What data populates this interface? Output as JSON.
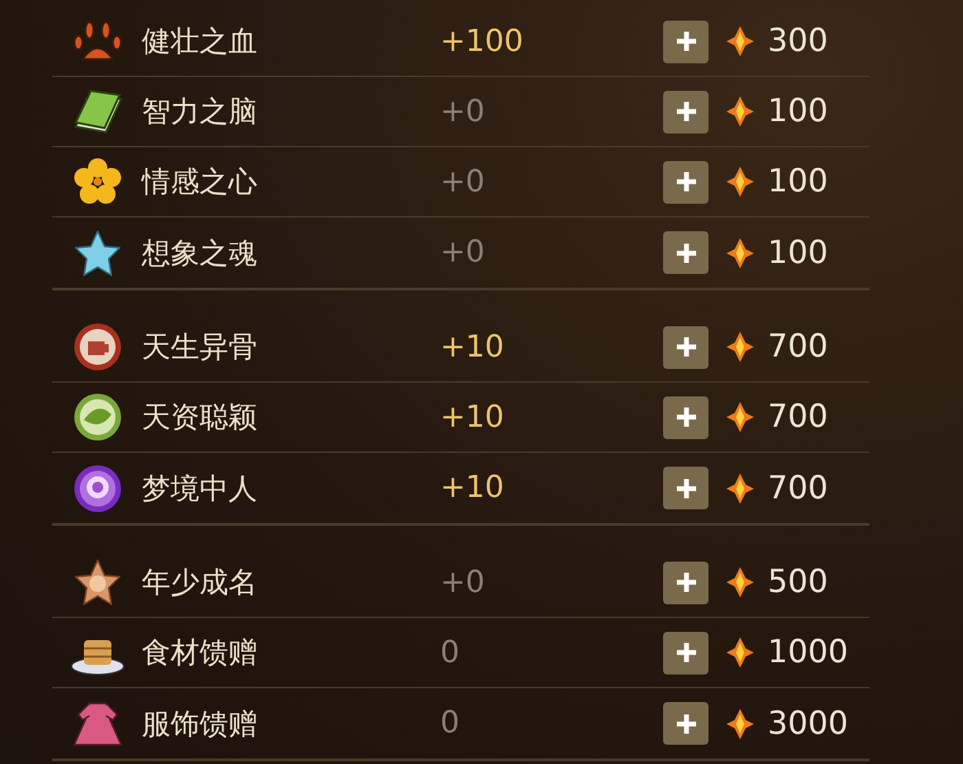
{
  "groups": [
    {
      "rows": [
        {
          "name": "健壮之血",
          "bonus": "+100",
          "highlighted": true,
          "cost": "300"
        },
        {
          "name": "智力之脑",
          "bonus": "+0",
          "highlighted": false,
          "cost": "100"
        },
        {
          "name": "情感之心",
          "bonus": "+0",
          "highlighted": false,
          "cost": "100"
        },
        {
          "name": "想象之魂",
          "bonus": "+0",
          "highlighted": false,
          "cost": "100"
        }
      ]
    },
    {
      "rows": [
        {
          "name": "天生异骨",
          "bonus": "+10",
          "highlighted": true,
          "cost": "700"
        },
        {
          "name": "天资聪颖",
          "bonus": "+10",
          "highlighted": true,
          "cost": "700"
        },
        {
          "name": "梦境中人",
          "bonus": "+10",
          "highlighted": true,
          "cost": "700"
        }
      ]
    },
    {
      "rows": [
        {
          "name": "年少成名",
          "bonus": "+0",
          "highlighted": false,
          "cost": "500"
        },
        {
          "name": "食材馈赠",
          "bonus": "0",
          "highlighted": false,
          "cost": "1000"
        },
        {
          "name": "服饰馈赠",
          "bonus": "0",
          "highlighted": false,
          "cost": "3000"
        }
      ]
    }
  ]
}
